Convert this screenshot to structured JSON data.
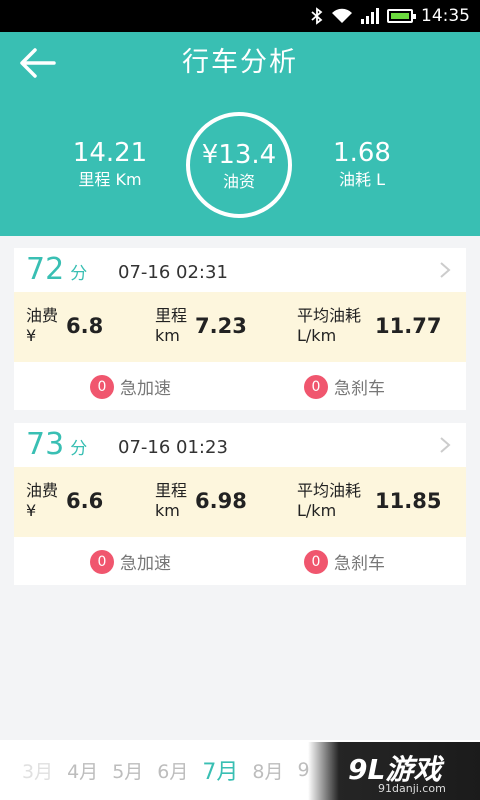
{
  "status_bar": {
    "time": "14:35",
    "battery_color": "#6ddc3f"
  },
  "header": {
    "title": "行车分析",
    "back_icon": "arrow-left-icon"
  },
  "summary": {
    "distance": {
      "value": "14.21",
      "label": "里程 Km"
    },
    "fuel_cost": {
      "value": "¥13.4",
      "label": "油资"
    },
    "fuel_consumption": {
      "value": "1.68",
      "label": "油耗 L"
    }
  },
  "trips": [
    {
      "score": "72",
      "score_unit": "分",
      "time": "07-16 02:31",
      "fuel_cost_label": "油费",
      "fuel_cost_unit": "¥",
      "fuel_cost": "6.8",
      "mileage_label": "里程",
      "mileage_unit": "km",
      "mileage": "7.23",
      "avg_label": "平均油耗",
      "avg_unit": "L/km",
      "avg": "11.77",
      "accel_count": "0",
      "accel_label": "急加速",
      "brake_count": "0",
      "brake_label": "急刹车"
    },
    {
      "score": "73",
      "score_unit": "分",
      "time": "07-16 01:23",
      "fuel_cost_label": "油费",
      "fuel_cost_unit": "¥",
      "fuel_cost": "6.6",
      "mileage_label": "里程",
      "mileage_unit": "km",
      "mileage": "6.98",
      "avg_label": "平均油耗",
      "avg_unit": "L/km",
      "avg": "11.85",
      "accel_count": "0",
      "accel_label": "急加速",
      "brake_count": "0",
      "brake_label": "急刹车"
    }
  ],
  "months": [
    "3月",
    "4月",
    "5月",
    "6月",
    "7月",
    "8月",
    "9"
  ],
  "active_month": "7月",
  "watermark": {
    "mark": "9L游戏",
    "url": "91danji.com"
  },
  "colors": {
    "accent": "#39bfb3",
    "highlight_row": "#fdf6dd",
    "badge": "#f0566e"
  }
}
